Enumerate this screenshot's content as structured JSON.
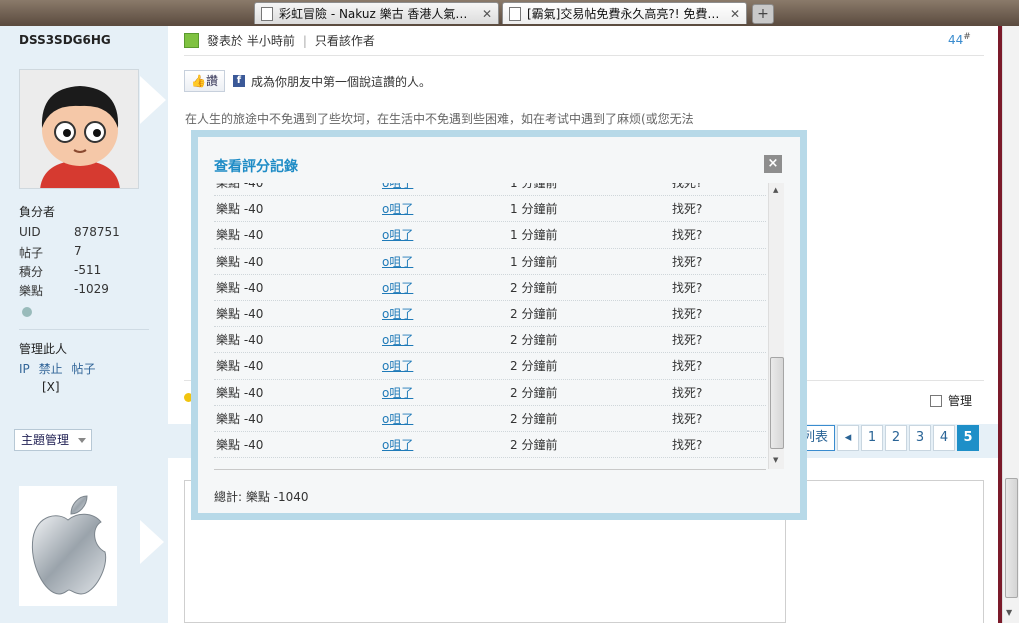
{
  "browser": {
    "tabs": [
      {
        "title": "彩虹冒險 - Nakuz 樂古 香港人氣網..."
      },
      {
        "title": "[霸氣]交易帖免費永久高亮?! 免費取..."
      }
    ],
    "new_tab": "+"
  },
  "sidebar": {
    "username": "DSS3SDG6HG",
    "user_title": "負分者",
    "stats": [
      {
        "key": "UID",
        "value": "878751"
      },
      {
        "key": "帖子",
        "value": "7"
      },
      {
        "key": "積分",
        "value": "-511"
      },
      {
        "key": "樂點",
        "value": "-1029"
      }
    ],
    "manage_label": "管理此人",
    "manage_links": [
      "IP",
      "禁止",
      "帖子"
    ],
    "manage_x": "[X]",
    "theme_manage": "主題管理"
  },
  "post": {
    "posted_label": "發表於 半小時前",
    "only_author": "只看該作者",
    "floor": "44",
    "floor_sup": "#",
    "like_btn": "讚",
    "like_text": "成為你朋友中第一個說這讚的人。",
    "body_text": "在人生的旅途中不免遇到了些坎坷，在生活中不免遇到些困难，如在考试中遇到了麻烦(或您无法",
    "manage": "管理"
  },
  "pager": {
    "list_label": "列表",
    "prev": "◂",
    "pages": [
      "1",
      "2",
      "3",
      "4",
      "5"
    ],
    "current": "5"
  },
  "modal": {
    "title": "查看評分記錄",
    "close": "×",
    "rows": [
      {
        "score": "樂點 -40",
        "user": "o咀了",
        "time": "1 分鐘前",
        "reason": "找死?"
      },
      {
        "score": "樂點 -40",
        "user": "o咀了",
        "time": "1 分鐘前",
        "reason": "找死?"
      },
      {
        "score": "樂點 -40",
        "user": "o咀了",
        "time": "1 分鐘前",
        "reason": "找死?"
      },
      {
        "score": "樂點 -40",
        "user": "o咀了",
        "time": "1 分鐘前",
        "reason": "找死?"
      },
      {
        "score": "樂點 -40",
        "user": "o咀了",
        "time": "2 分鐘前",
        "reason": "找死?"
      },
      {
        "score": "樂點 -40",
        "user": "o咀了",
        "time": "2 分鐘前",
        "reason": "找死?"
      },
      {
        "score": "樂點 -40",
        "user": "o咀了",
        "time": "2 分鐘前",
        "reason": "找死?"
      },
      {
        "score": "樂點 -40",
        "user": "o咀了",
        "time": "2 分鐘前",
        "reason": "找死?"
      },
      {
        "score": "樂點 -40",
        "user": "o咀了",
        "time": "2 分鐘前",
        "reason": "找死?"
      },
      {
        "score": "樂點 -40",
        "user": "o咀了",
        "time": "2 分鐘前",
        "reason": "找死?"
      },
      {
        "score": "樂點 -40",
        "user": "o咀了",
        "time": "2 分鐘前",
        "reason": "找死?"
      }
    ],
    "total": "總計: 樂點 -1040"
  }
}
